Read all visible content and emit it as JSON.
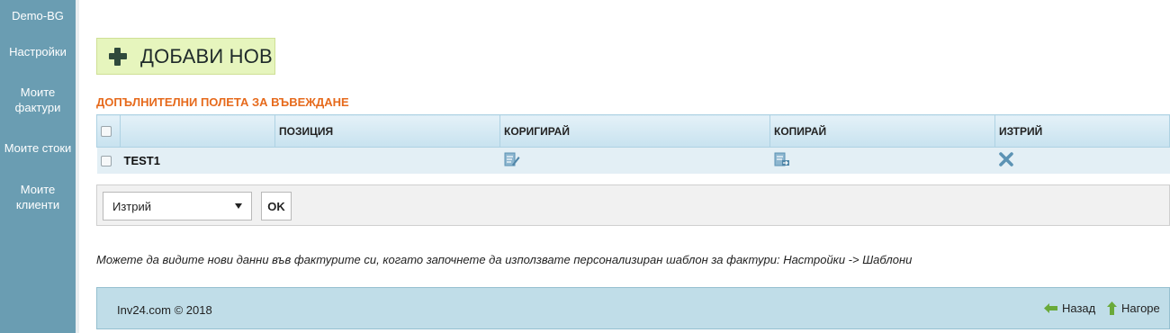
{
  "sidebar": {
    "items": [
      {
        "label": "Demo-BG"
      },
      {
        "label": "Настройки"
      },
      {
        "label": "Моите фактури"
      },
      {
        "label": "Моите стоки"
      },
      {
        "label": "Моите клиенти"
      }
    ]
  },
  "main": {
    "add_button_label": "ДОБАВИ НОВ",
    "section_title": "ДОПЪЛНИТЕЛНИ ПОЛЕТА ЗА ВЪВЕЖДАНЕ",
    "table": {
      "columns": [
        "",
        "",
        "ПОЗИЦИЯ",
        "КОРИГИРАЙ",
        "КОПИРАЙ",
        "ИЗТРИЙ"
      ],
      "rows": [
        {
          "name": "TEST1",
          "position": ""
        }
      ]
    },
    "bulk_action": {
      "selected": "Изтрий",
      "ok_label": "OK"
    },
    "info_text": "Можете да видите нови данни във фактурите си, когато започнете да използвате персонализиран шаблон за фактури: Настройки -> Шаблони"
  },
  "footer": {
    "copyright": "Inv24.com © 2018",
    "back_label": "Назад",
    "top_label": "Нагоре"
  },
  "icons": {
    "add": "plus-icon",
    "edit": "edit-document-icon",
    "copy": "copy-document-icon",
    "delete": "close-x-icon",
    "back": "arrow-left-icon",
    "top": "arrow-up-icon"
  },
  "colors": {
    "sidebar": "#6a9db2",
    "section_title": "#e66a1c",
    "add_button_bg": "#e6f5bd",
    "footer_bg": "#c0dde8",
    "icon_blue": "#5c93b4",
    "footer_arrow_green": "#6aaa3a"
  }
}
